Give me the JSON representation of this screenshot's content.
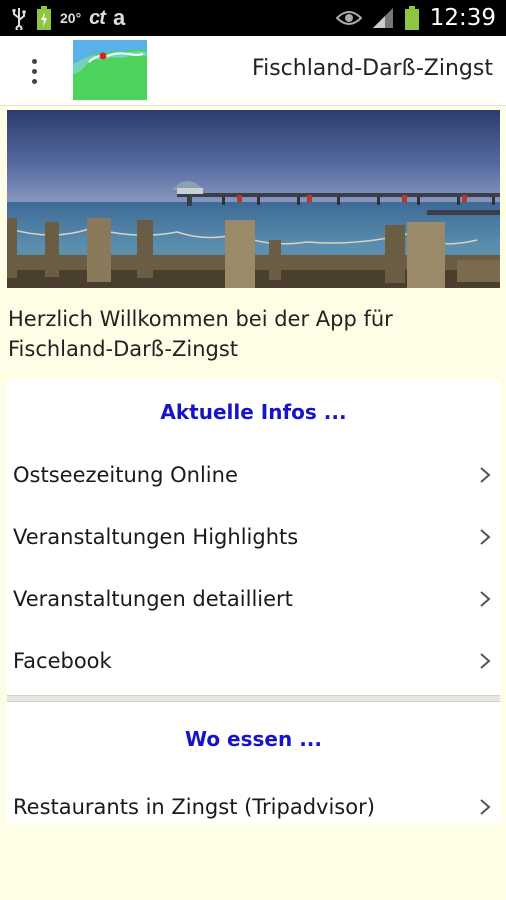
{
  "status_bar": {
    "temperature": "20°",
    "ct_label": "ct",
    "a_label": "a",
    "time": "12:39"
  },
  "action_bar": {
    "title": "Fischland-Darß-Zingst"
  },
  "welcome_text": "Herzlich Willkommen bei der App für Fischland-Darß-Zingst",
  "sections": [
    {
      "title": "Aktuelle Infos ...",
      "items": [
        "Ostseezeitung Online",
        "Veranstaltungen Highlights",
        "Veranstaltungen detailliert",
        "Facebook"
      ]
    },
    {
      "title": "Wo essen ...",
      "items": [
        "Restaurants in Zingst (Tripadvisor)"
      ]
    }
  ],
  "colors": {
    "page_background": "#fefee6",
    "section_title": "#1515c6",
    "logo_background": "#4cd35c"
  }
}
